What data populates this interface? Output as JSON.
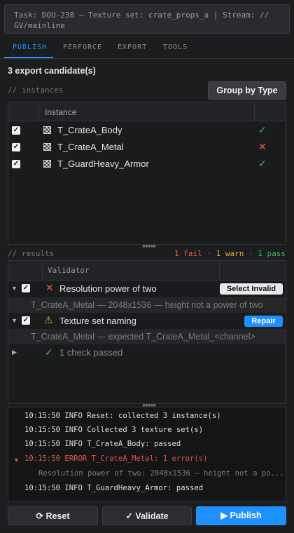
{
  "task_line1": "Task: DOU-238 — Texture set: crate_props_a  |  Stream: //",
  "task_line2": "GV/mainline",
  "tabs": [
    "PUBLISH",
    "PERFORCE",
    "EXPORT",
    "TOOLS"
  ],
  "candidates_title": "3 export candidate(s)",
  "instances_label": "// instances",
  "group_button": "Group by Type",
  "instance_header": "Instance",
  "instances": [
    {
      "name": "T_CrateA_Body",
      "status": "✓"
    },
    {
      "name": "T_CrateA_Metal",
      "status": "✕"
    },
    {
      "name": "T_GuardHeavy_Armor",
      "status": "✓"
    }
  ],
  "results_label": "// results",
  "summary": {
    "fail": "1 fail",
    "warn": "1 warn",
    "pass": "1 pass",
    "sep": "·"
  },
  "validator_header": "Validator",
  "validators": [
    {
      "name": "Resolution power of two",
      "detail": "T_CrateA_Metal — 2048x1536 — height not a power of two",
      "action": "Select Invalid"
    },
    {
      "name": "Texture set naming",
      "detail": "T_CrateA_Metal — expected T_CrateA_Metal_<channel>",
      "action": "Repair"
    }
  ],
  "passed_label": "1 check passed",
  "log": [
    "10:15:50  INFO  Reset: collected 3 instance(s)",
    "10:15:50  INFO  Collected 3 texture set(s)",
    "10:15:50  INFO  T_CrateA_Body: passed",
    "10:15:50  ERROR T_CrateA_Metal: 1 error(s)",
    "Resolution power of two: 2048x1536 — height not a po...",
    "10:15:50  INFO  T_GuardHeavy_Armor: passed"
  ],
  "buttons": {
    "reset": "⟳ Reset",
    "validate": "✓ Validate",
    "publish": "▶ Publish"
  },
  "colors": {
    "accent": "#1e90ff",
    "pass": "#3fb950",
    "fail": "#f0573c",
    "warn": "#e5a52f"
  },
  "icons": {
    "instance": "texture-icon",
    "pass": "check-icon",
    "fail": "x-icon",
    "warn": "warning-icon"
  }
}
